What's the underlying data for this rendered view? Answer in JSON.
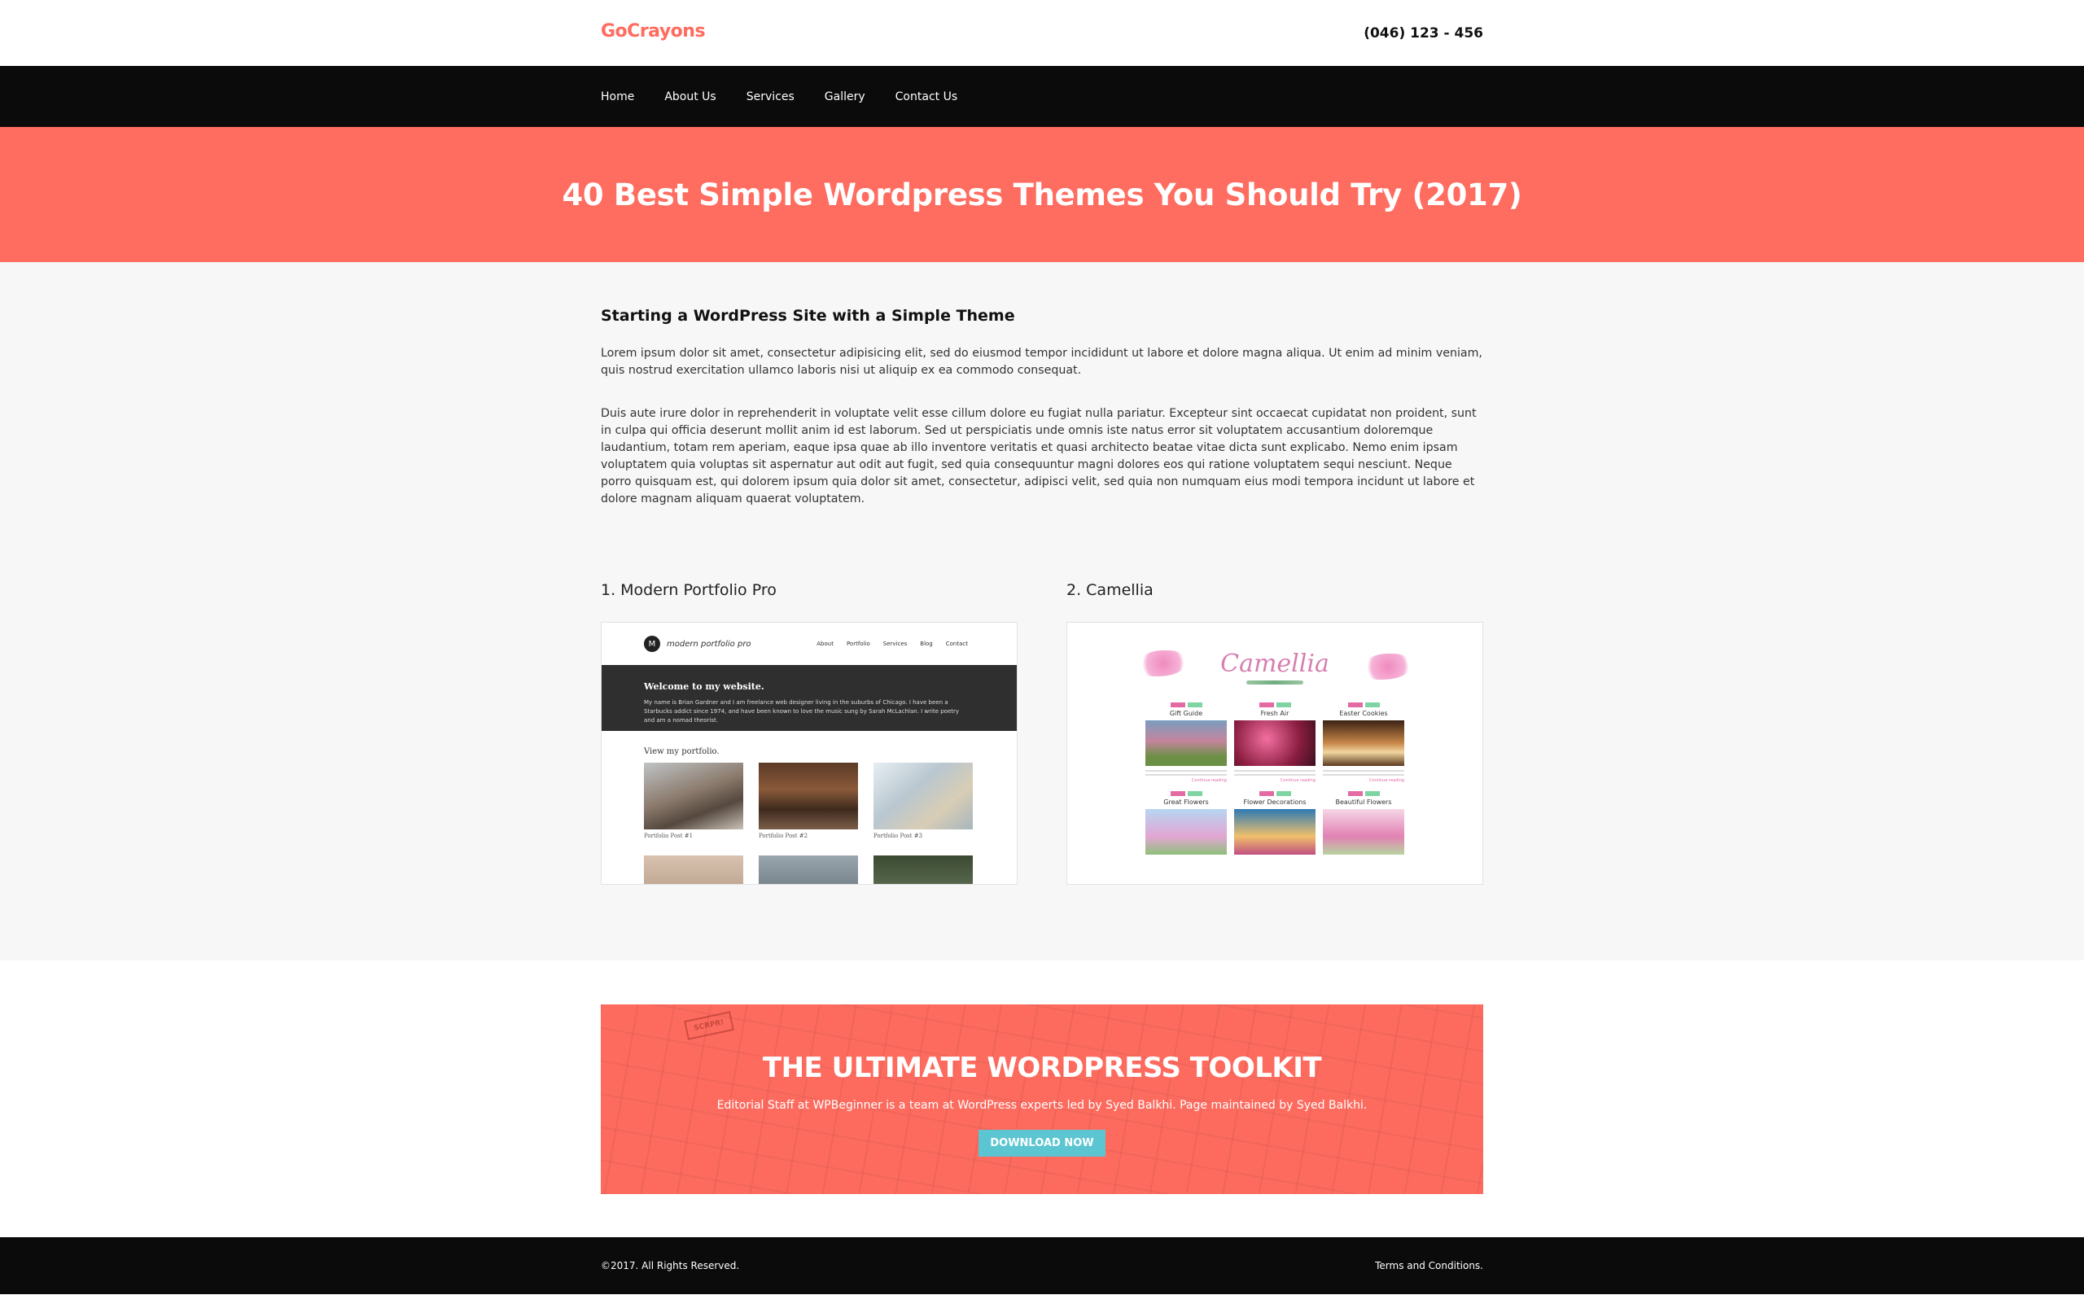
{
  "header": {
    "logo": "GoCrayons",
    "phone": "(046) 123 - 456"
  },
  "nav": {
    "items": [
      {
        "label": "Home"
      },
      {
        "label": "About Us"
      },
      {
        "label": "Services"
      },
      {
        "label": "Gallery"
      },
      {
        "label": "Contact Us"
      }
    ]
  },
  "colors": {
    "accent": "#ff6c60",
    "dark": "#0b0b0b",
    "button": "#5bc6d1"
  },
  "hero": {
    "title": "40 Best Simple Wordpress Themes You Should Try (2017)"
  },
  "article": {
    "heading": "Starting a WordPress Site with a Simple Theme",
    "paragraphs": [
      "Lorem ipsum dolor sit amet, consectetur adipisicing elit, sed do eiusmod tempor incididunt ut labore et dolore magna aliqua. Ut enim ad minim veniam, quis nostrud exercitation ullamco laboris nisi ut aliquip ex ea commodo consequat.",
      "Duis aute irure dolor in reprehenderit in voluptate velit esse cillum dolore eu fugiat nulla pariatur. Excepteur sint occaecat cupidatat non proident, sunt in culpa qui officia deserunt mollit anim id est laborum. Sed ut perspiciatis unde omnis iste natus error sit voluptatem accusantium doloremque laudantium, totam rem aperiam, eaque ipsa quae ab illo inventore veritatis et quasi architecto beatae vitae dicta sunt explicabo. Nemo enim ipsam voluptatem quia voluptas sit aspernatur aut odit aut fugit, sed quia consequuntur magni dolores eos qui ratione voluptatem sequi nesciunt. Neque porro quisquam est, qui dolorem ipsum quia dolor sit amet, consectetur, adipisci velit, sed quia non numquam eius modi tempora incidunt ut labore et dolore magnam aliquam quaerat voluptatem."
    ]
  },
  "themes": [
    {
      "title": "1. Modern Portfolio Pro",
      "preview": {
        "brand": "modern portfolio pro",
        "monogram": "M",
        "links": [
          "About",
          "Portfolio",
          "Services",
          "Blog",
          "Contact"
        ],
        "banner_title": "Welcome to my website.",
        "banner_text": "My name is Brian Gardner and I am freelance web designer living in the suburbs of Chicago. I have been a Starbucks addict since 1974, and have been known to love the music sung by Sarah McLachlan. I write poetry and am a nomad theorist.",
        "section_title": "View my portfolio.",
        "posts": [
          "Portfolio Post #1",
          "Portfolio Post #2",
          "Portfolio Post #3"
        ]
      }
    },
    {
      "title": "2. Camellia",
      "preview": {
        "brand": "Camellia",
        "posts": [
          "Gift Guide",
          "Fresh Air",
          "Easter Cookies",
          "Great Flowers",
          "Flower Decorations",
          "Beautiful Flowers"
        ],
        "more_label": "Continue reading"
      }
    }
  ],
  "cta": {
    "stamp": "SCRPR!",
    "title": "THE ULTIMATE WORDPRESS TOOLKIT",
    "text": "Editorial Staff at WPBeginner is a team at WordPress experts led by Syed Balkhi. Page maintained by Syed Balkhi.",
    "button": "DOWNLOAD NOW"
  },
  "footer": {
    "copyright": "©2017. All Rights Reserved.",
    "terms": "Terms and Conditions."
  }
}
